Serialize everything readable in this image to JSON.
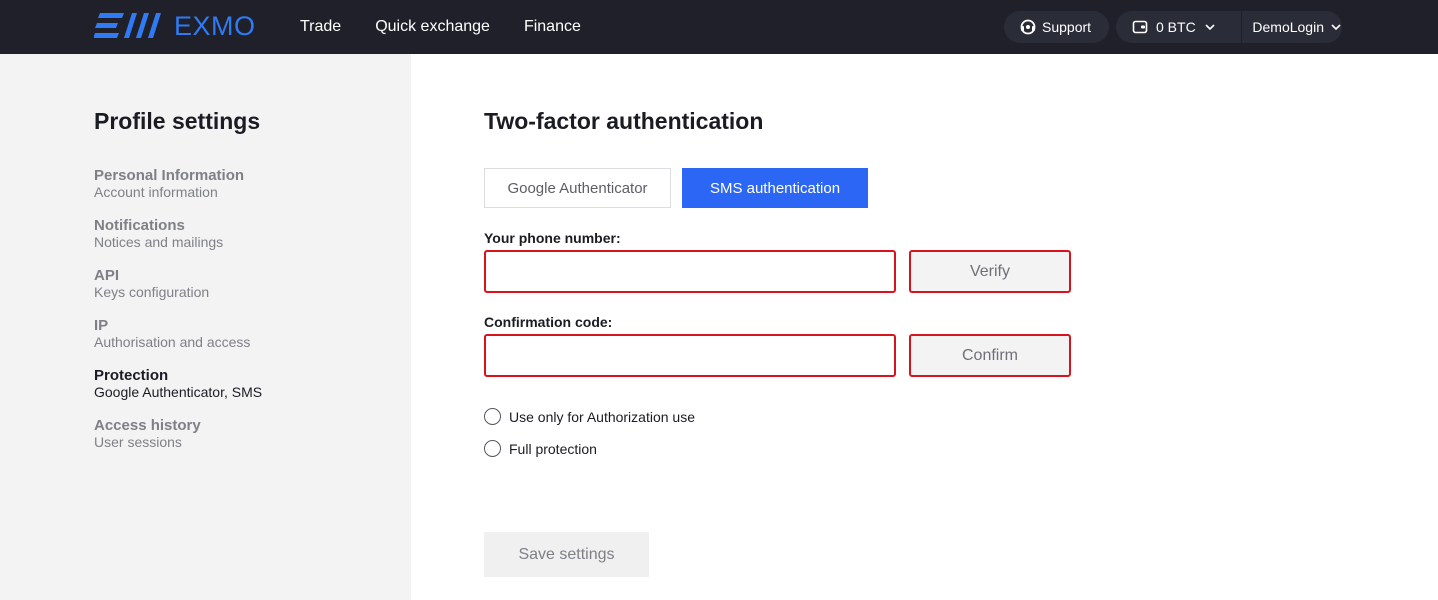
{
  "header": {
    "brand": "EXMO",
    "brand_color": "#2f7bf5",
    "nav": [
      {
        "label": "Trade"
      },
      {
        "label": "Quick exchange"
      },
      {
        "label": "Finance"
      }
    ],
    "support_label": "Support",
    "balance": "0 BTC",
    "user": "DemoLogin",
    "icons": {
      "support": "headset-icon",
      "wallet": "wallet-icon",
      "dropdown": "chevron-down-icon"
    }
  },
  "sidebar": {
    "title": "Profile settings",
    "items": [
      {
        "label": "Personal Information",
        "sub": "Account information",
        "active": false
      },
      {
        "label": "Notifications",
        "sub": "Notices and mailings",
        "active": false
      },
      {
        "label": "API",
        "sub": "Keys configuration",
        "active": false
      },
      {
        "label": "IP",
        "sub": "Authorisation and access",
        "active": false
      },
      {
        "label": "Protection",
        "sub": "Google Authenticator, SMS",
        "active": true
      },
      {
        "label": "Access history",
        "sub": "User sessions",
        "active": false
      }
    ]
  },
  "main": {
    "title": "Two-factor authentication",
    "tabs": [
      {
        "label": "Google Authenticator",
        "active": false
      },
      {
        "label": "SMS authentication",
        "active": true
      }
    ],
    "phone": {
      "label": "Your phone number:",
      "value": "",
      "placeholder": "",
      "button": "Verify"
    },
    "code": {
      "label": "Confirmation code:",
      "value": "",
      "placeholder": "",
      "button": "Confirm"
    },
    "options": [
      {
        "label": "Use only for Authorization use",
        "selected": false
      },
      {
        "label": "Full protection",
        "selected": false
      }
    ],
    "save_label": "Save settings",
    "colors": {
      "accent": "#2c66f4",
      "error_border": "#d9131c"
    }
  }
}
